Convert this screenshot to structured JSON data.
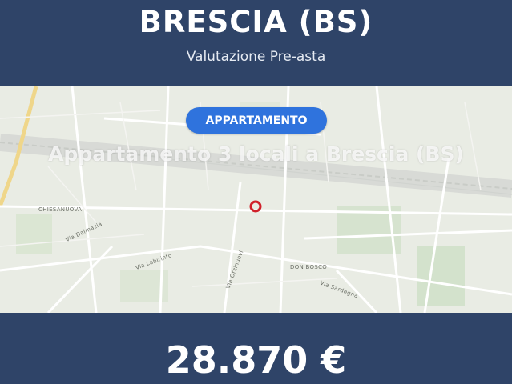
{
  "header": {
    "city": "BRESCIA (BS)",
    "subtitle": "Valutazione Pre-asta"
  },
  "listing": {
    "category_badge": "APPARTAMENTO",
    "title": "Appartamento 3 locali a Brescia (BS)"
  },
  "map": {
    "labels": {
      "area_west": "CHIESANUOVA",
      "area_center": "DON BOSCO",
      "street_1": "Via Dalmazia",
      "street_2": "Via Labirinto",
      "street_3": "Via Orzinuovi",
      "street_4": "Via Sardegna"
    },
    "marker_icon": "location-ring-icon",
    "marker_color": "#d0202a"
  },
  "footer": {
    "price": "28.870 €"
  },
  "colors": {
    "banner": "#2f4468",
    "badge": "#2f73dd",
    "map_bg": "#e9ece4"
  }
}
